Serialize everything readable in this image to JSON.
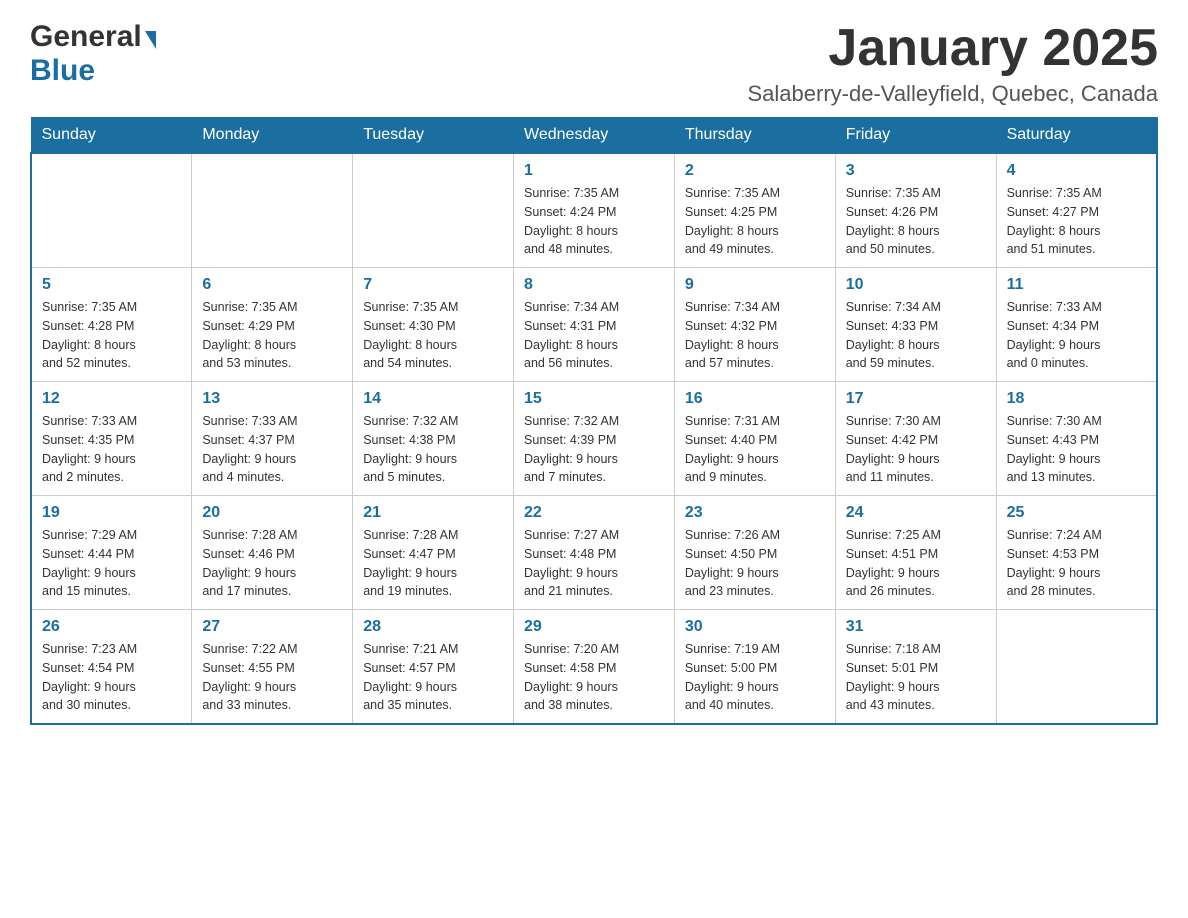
{
  "header": {
    "logo_general": "General",
    "logo_blue": "Blue",
    "month_title": "January 2025",
    "location": "Salaberry-de-Valleyfield, Quebec, Canada"
  },
  "weekdays": [
    "Sunday",
    "Monday",
    "Tuesday",
    "Wednesday",
    "Thursday",
    "Friday",
    "Saturday"
  ],
  "weeks": [
    [
      {
        "day": "",
        "info": ""
      },
      {
        "day": "",
        "info": ""
      },
      {
        "day": "",
        "info": ""
      },
      {
        "day": "1",
        "info": "Sunrise: 7:35 AM\nSunset: 4:24 PM\nDaylight: 8 hours\nand 48 minutes."
      },
      {
        "day": "2",
        "info": "Sunrise: 7:35 AM\nSunset: 4:25 PM\nDaylight: 8 hours\nand 49 minutes."
      },
      {
        "day": "3",
        "info": "Sunrise: 7:35 AM\nSunset: 4:26 PM\nDaylight: 8 hours\nand 50 minutes."
      },
      {
        "day": "4",
        "info": "Sunrise: 7:35 AM\nSunset: 4:27 PM\nDaylight: 8 hours\nand 51 minutes."
      }
    ],
    [
      {
        "day": "5",
        "info": "Sunrise: 7:35 AM\nSunset: 4:28 PM\nDaylight: 8 hours\nand 52 minutes."
      },
      {
        "day": "6",
        "info": "Sunrise: 7:35 AM\nSunset: 4:29 PM\nDaylight: 8 hours\nand 53 minutes."
      },
      {
        "day": "7",
        "info": "Sunrise: 7:35 AM\nSunset: 4:30 PM\nDaylight: 8 hours\nand 54 minutes."
      },
      {
        "day": "8",
        "info": "Sunrise: 7:34 AM\nSunset: 4:31 PM\nDaylight: 8 hours\nand 56 minutes."
      },
      {
        "day": "9",
        "info": "Sunrise: 7:34 AM\nSunset: 4:32 PM\nDaylight: 8 hours\nand 57 minutes."
      },
      {
        "day": "10",
        "info": "Sunrise: 7:34 AM\nSunset: 4:33 PM\nDaylight: 8 hours\nand 59 minutes."
      },
      {
        "day": "11",
        "info": "Sunrise: 7:33 AM\nSunset: 4:34 PM\nDaylight: 9 hours\nand 0 minutes."
      }
    ],
    [
      {
        "day": "12",
        "info": "Sunrise: 7:33 AM\nSunset: 4:35 PM\nDaylight: 9 hours\nand 2 minutes."
      },
      {
        "day": "13",
        "info": "Sunrise: 7:33 AM\nSunset: 4:37 PM\nDaylight: 9 hours\nand 4 minutes."
      },
      {
        "day": "14",
        "info": "Sunrise: 7:32 AM\nSunset: 4:38 PM\nDaylight: 9 hours\nand 5 minutes."
      },
      {
        "day": "15",
        "info": "Sunrise: 7:32 AM\nSunset: 4:39 PM\nDaylight: 9 hours\nand 7 minutes."
      },
      {
        "day": "16",
        "info": "Sunrise: 7:31 AM\nSunset: 4:40 PM\nDaylight: 9 hours\nand 9 minutes."
      },
      {
        "day": "17",
        "info": "Sunrise: 7:30 AM\nSunset: 4:42 PM\nDaylight: 9 hours\nand 11 minutes."
      },
      {
        "day": "18",
        "info": "Sunrise: 7:30 AM\nSunset: 4:43 PM\nDaylight: 9 hours\nand 13 minutes."
      }
    ],
    [
      {
        "day": "19",
        "info": "Sunrise: 7:29 AM\nSunset: 4:44 PM\nDaylight: 9 hours\nand 15 minutes."
      },
      {
        "day": "20",
        "info": "Sunrise: 7:28 AM\nSunset: 4:46 PM\nDaylight: 9 hours\nand 17 minutes."
      },
      {
        "day": "21",
        "info": "Sunrise: 7:28 AM\nSunset: 4:47 PM\nDaylight: 9 hours\nand 19 minutes."
      },
      {
        "day": "22",
        "info": "Sunrise: 7:27 AM\nSunset: 4:48 PM\nDaylight: 9 hours\nand 21 minutes."
      },
      {
        "day": "23",
        "info": "Sunrise: 7:26 AM\nSunset: 4:50 PM\nDaylight: 9 hours\nand 23 minutes."
      },
      {
        "day": "24",
        "info": "Sunrise: 7:25 AM\nSunset: 4:51 PM\nDaylight: 9 hours\nand 26 minutes."
      },
      {
        "day": "25",
        "info": "Sunrise: 7:24 AM\nSunset: 4:53 PM\nDaylight: 9 hours\nand 28 minutes."
      }
    ],
    [
      {
        "day": "26",
        "info": "Sunrise: 7:23 AM\nSunset: 4:54 PM\nDaylight: 9 hours\nand 30 minutes."
      },
      {
        "day": "27",
        "info": "Sunrise: 7:22 AM\nSunset: 4:55 PM\nDaylight: 9 hours\nand 33 minutes."
      },
      {
        "day": "28",
        "info": "Sunrise: 7:21 AM\nSunset: 4:57 PM\nDaylight: 9 hours\nand 35 minutes."
      },
      {
        "day": "29",
        "info": "Sunrise: 7:20 AM\nSunset: 4:58 PM\nDaylight: 9 hours\nand 38 minutes."
      },
      {
        "day": "30",
        "info": "Sunrise: 7:19 AM\nSunset: 5:00 PM\nDaylight: 9 hours\nand 40 minutes."
      },
      {
        "day": "31",
        "info": "Sunrise: 7:18 AM\nSunset: 5:01 PM\nDaylight: 9 hours\nand 43 minutes."
      },
      {
        "day": "",
        "info": ""
      }
    ]
  ]
}
